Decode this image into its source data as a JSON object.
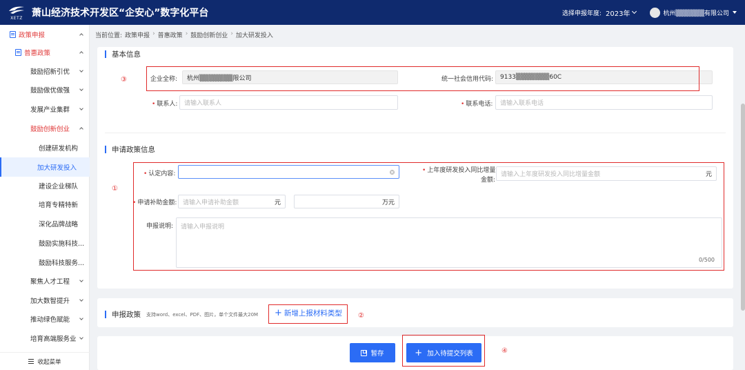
{
  "header": {
    "logo_text": "XETZ",
    "title": "萧山经济技术开发区“企安心”数字化平台",
    "year_label": "选择申报年度:",
    "year_value": "2023年",
    "user_name": "杭州▒▒▒▒▒▒有限公司"
  },
  "sidebar": {
    "items": [
      {
        "label": "政策申报"
      },
      {
        "label": "普惠政策"
      },
      {
        "label": "鼓励招新引优"
      },
      {
        "label": "鼓励做优做强"
      },
      {
        "label": "发展产业集群"
      },
      {
        "label": "鼓励创新创业"
      },
      {
        "label": "创建研发机构"
      },
      {
        "label": "加大研发投入"
      },
      {
        "label": "建设企业梯队"
      },
      {
        "label": "培育专精特新"
      },
      {
        "label": "深化品牌战略"
      },
      {
        "label": "鼓励实施科技..."
      },
      {
        "label": "鼓励科技服务..."
      },
      {
        "label": "聚焦人才工程"
      },
      {
        "label": "加大数智提升"
      },
      {
        "label": "推动绿色赋能"
      },
      {
        "label": "培育高端服务业"
      }
    ],
    "collapse_label": "收起菜单"
  },
  "breadcrumb": {
    "prefix": "当前位置:",
    "items": [
      "政策申报",
      "普惠政策",
      "鼓励创新创业",
      "加大研发投入"
    ]
  },
  "basic_info": {
    "title": "基本信息",
    "company_label": "企业全称:",
    "company_value": "杭州▒▒▒▒▒▒▒限公司",
    "credit_label": "统一社会信用代码:",
    "credit_value": "9133▒▒▒▒▒▒▒60C",
    "contact_label": "联系人:",
    "contact_placeholder": "请输入联系人",
    "phone_label": "联系电话:",
    "phone_placeholder": "请输入联系电话"
  },
  "apply_info": {
    "title": "申请政策信息",
    "certify_label": "认定内容:",
    "increase_label_1": "上年度研发投入同比增量",
    "increase_label_2": "金额:",
    "increase_placeholder": "请输入上年度研发投入同比增量金额",
    "increase_unit": "元",
    "subsidy_label": "申请补助金额:",
    "subsidy_placeholder": "请输入申请补助金额",
    "subsidy_unit": "元",
    "subsidy_unit_wan": "万元",
    "desc_label": "申报说明:",
    "desc_placeholder": "请输入申报说明",
    "desc_count": "0/500"
  },
  "materials": {
    "title": "申报政策",
    "hint": "支持word、excel、PDF、图片，单个文件最大20M",
    "add_label": "新增上报材料类型"
  },
  "actions": {
    "save_label": "暂存",
    "submit_label": "加入待提交列表"
  },
  "annotations": {
    "a1": "①",
    "a2": "②",
    "a3": "③",
    "a4": "④"
  },
  "colors": {
    "header_bg": "#0f2a6e",
    "accent": "#2b6cf5",
    "annotation": "#e02a2a"
  }
}
